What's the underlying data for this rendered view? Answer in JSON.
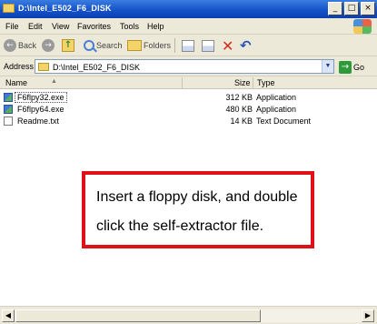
{
  "window": {
    "title": "D:\\Intel_E502_F6_DISK",
    "buttons": {
      "minimize": "_",
      "maximize": "□",
      "close": "×"
    }
  },
  "menubar": {
    "items": [
      "File",
      "Edit",
      "View",
      "Favorites",
      "Tools",
      "Help"
    ]
  },
  "toolbar": {
    "back_label": "Back",
    "back_glyph": "←",
    "forward_glyph": "→",
    "up_glyph": "↑",
    "search_label": "Search",
    "folders_label": "Folders",
    "delete_glyph": "✕",
    "undo_glyph": "↶"
  },
  "addressbar": {
    "label": "Address",
    "value": "D:\\Intel_E502_F6_DISK",
    "dropdown_glyph": "▼",
    "go_label": "Go",
    "go_glyph": "→"
  },
  "columns": {
    "name": "Name",
    "size": "Size",
    "type": "Type",
    "sort_glyph": "▲"
  },
  "files": [
    {
      "name": "F6flpy32.exe",
      "size": "312 KB",
      "type": "Application",
      "icon": "exe-icon"
    },
    {
      "name": "F6flpy64.exe",
      "size": "480 KB",
      "type": "Application",
      "icon": "exe-icon"
    },
    {
      "name": "Readme.txt",
      "size": "14 KB",
      "type": "Text Document",
      "icon": "text-file-icon"
    }
  ],
  "callout": {
    "text": "Insert a floppy disk, and double click the self-extractor file.",
    "border_color": "#e01019"
  },
  "scrollbar": {
    "left_glyph": "◀",
    "right_glyph": "▶"
  },
  "colors": {
    "titlebar": "#1553c9",
    "chrome": "#ece9d8"
  }
}
